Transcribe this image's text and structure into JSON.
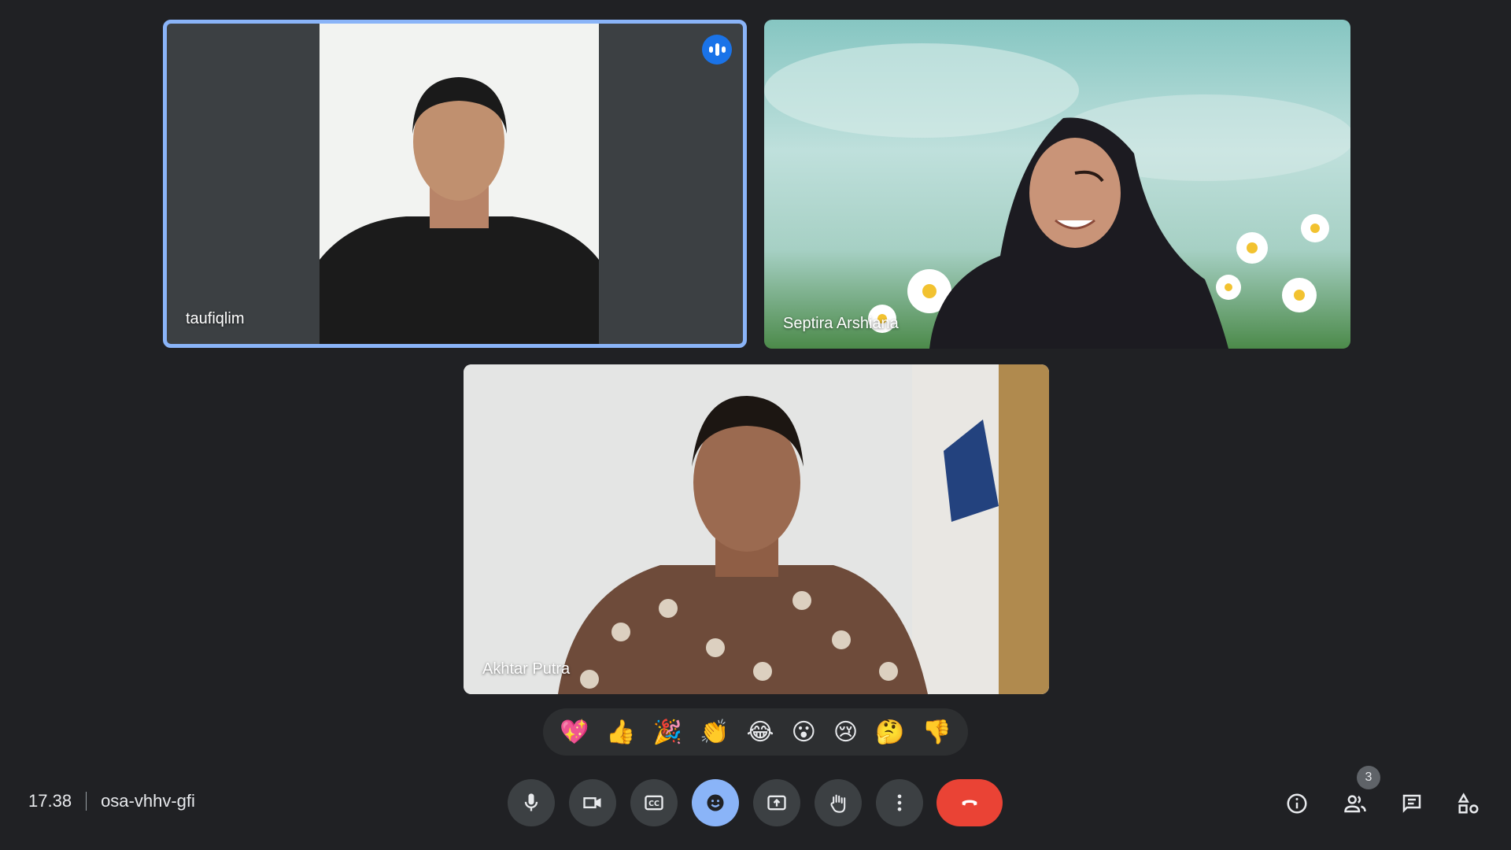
{
  "participants": [
    {
      "name": "taufiqlim",
      "speaking": true
    },
    {
      "name": "Septira Arshiana"
    },
    {
      "name": "Akhtar Putra"
    }
  ],
  "reactions": [
    "💖",
    "👍",
    "🎉",
    "👏",
    "😂",
    "😮",
    "😢",
    "🤔",
    "👎"
  ],
  "meeting": {
    "time": "17.38",
    "code": "osa-vhhv-gfi"
  },
  "participant_count": "3",
  "controls": [
    "mic-icon",
    "camera-icon",
    "captions-icon",
    "emoji-icon",
    "present-icon",
    "raise-hand-icon",
    "more-options-icon",
    "end-call-icon"
  ],
  "right_icons": [
    "info-icon",
    "people-icon",
    "chat-icon",
    "activities-icon"
  ],
  "colors": {
    "background": "#202124",
    "tile": "#3c4043",
    "accent": "#8ab4f8",
    "end_call": "#ea4335",
    "speaking_badge": "#1a73e8"
  }
}
